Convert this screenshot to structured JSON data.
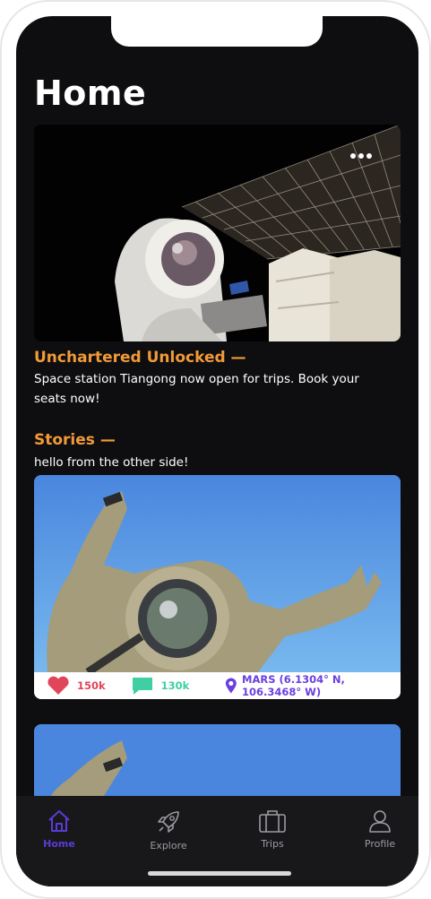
{
  "header": {
    "title": "Home"
  },
  "featured": {
    "heading": "Unchartered Unlocked —",
    "description": "Space station Tiangong now open for trips. Book your seats now!"
  },
  "stories": {
    "heading": "Stories —",
    "caption": "hello from the other side!",
    "posts": [
      {
        "likes": "150k",
        "comments": "130k",
        "location": "MARS (6.1304° N, 106.3468° W)"
      }
    ]
  },
  "tabs": [
    {
      "label": "Home",
      "icon": "home-icon",
      "active": true
    },
    {
      "label": "Explore",
      "icon": "rocket-icon",
      "active": false
    },
    {
      "label": "Trips",
      "icon": "suitcase-icon",
      "active": false
    },
    {
      "label": "Profile",
      "icon": "user-icon",
      "active": false
    }
  ],
  "colors": {
    "accent": "#f29a38",
    "tab_active": "#5b3bd6",
    "like": "#e0455a",
    "comment": "#3fcfa2",
    "location": "#6a3fe0"
  }
}
